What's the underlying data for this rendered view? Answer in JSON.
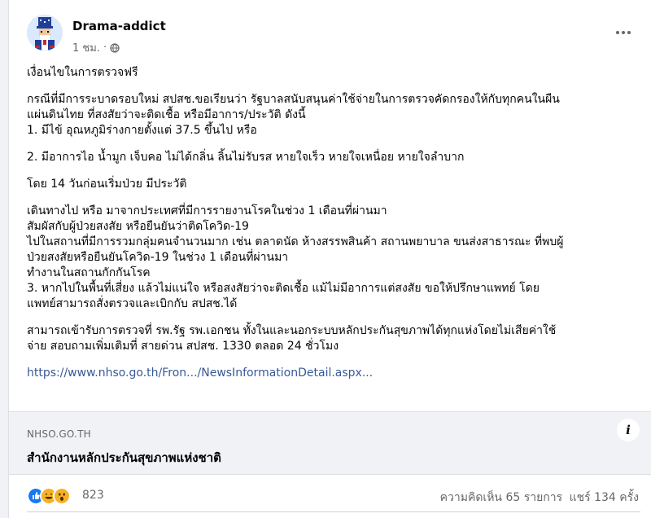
{
  "post": {
    "author": "Drama-addict",
    "time": "1 ชม.",
    "privacy_icon": "globe-icon",
    "avatar": "uncle-sam-avatar",
    "paragraphs": [
      [
        "เงื่อนไขในการตรวจฟรี"
      ],
      [
        "กรณีที่มีการระบาดรอบใหม่ สปสช.ขอเรียนว่า รัฐบาลสนับสนุนค่าใช้จ่ายในการตรวจคัดกรองให้กับทุกคนในผืน",
        "แผ่นดินไทย ที่สงสัยว่าจะติดเชื้อ หรือมีอาการ/ประวัติ ดังนี้",
        "1. มีไข้ อุณหภูมิร่างกายตั้งแต่ 37.5 ขึ้นไป หรือ"
      ],
      [
        "2. มีอาการไอ น้ำมูก เจ็บคอ ไม่ได้กลิ่น ลิ้นไม่รับรส หายใจเร็ว หายใจเหนื่อย หายใจลำบาก"
      ],
      [
        "โดย 14 วันก่อนเริ่มป่วย มีประวัติ"
      ],
      [
        "เดินทางไป หรือ มาจากประเทศที่มีการรายงานโรคในช่วง 1 เดือนที่ผ่านมา",
        "สัมผัสกับผู้ป่วยสงสัย หรือยืนยันว่าติดโควิด-19",
        "ไปในสถานที่มีการรวมกลุ่มคนจำนวนมาก เช่น ตลาดนัด ห้างสรรพสินค้า สถานพยาบาล ขนส่งสาธารณะ ที่พบผู้",
        "ป่วยสงสัยหรือยืนยันโควิด-19 ในช่วง 1 เดือนที่ผ่านมา",
        "ทำงานในสถานกักกันโรค",
        "3. หากไปในพื้นที่เสี่ยง แล้วไม่แน่ใจ หรือสงสัยว่าจะติดเชื้อ แม้ไม่มีอาการแต่สงสัย ขอให้ปรึกษาแพทย์ โดย",
        "แพทย์สามารถสั่งตรวจและเบิกกับ สปสช.ได้"
      ],
      [
        "สามารถเข้ารับการตรวจที่ รพ.รัฐ รพ.เอกชน ทั้งในและนอกระบบหลักประกันสุขภาพได้ทุกแห่งโดยไม่เสียค่าใช้",
        "จ่าย สอบถามเพิ่มเติมที่ สายด่วน สปสช. 1330 ตลอด 24 ชั่วโมง"
      ]
    ],
    "link": "https://www.nhso.go.th/Fron.../NewsInformationDetail.aspx..."
  },
  "preview": {
    "domain": "NHSO.GO.TH",
    "title": "สำนักงานหลักประกันสุขภาพแห่งชาติ",
    "info_icon": "i"
  },
  "stats": {
    "reaction_icons": [
      "like-icon",
      "haha-icon",
      "wow-icon"
    ],
    "reaction_count": "823",
    "comments": "ความคิดเห็น 65 รายการ",
    "shares": "แชร์ 134 ครั้ง"
  },
  "colors": {
    "link": "#385898",
    "like": "#1877f2",
    "haha": "#f7b125",
    "secondary_text": "#65676b"
  }
}
